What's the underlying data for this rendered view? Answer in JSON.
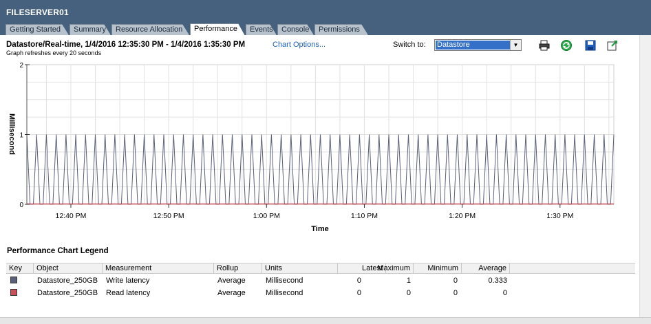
{
  "window": {
    "title": "FILESERVER01"
  },
  "tabs": [
    {
      "label": "Getting Started",
      "active": false
    },
    {
      "label": "Summary",
      "active": false
    },
    {
      "label": "Resource Allocation",
      "active": false
    },
    {
      "label": "Performance",
      "active": true
    },
    {
      "label": "Events",
      "active": false
    },
    {
      "label": "Console",
      "active": false
    },
    {
      "label": "Permissions",
      "active": false
    }
  ],
  "header": {
    "title": "Datastore/Real-time, 1/4/2016 12:35:30 PM - 1/4/2016 1:35:30 PM",
    "chart_options_link": "Chart Options...",
    "refresh_note": "Graph refreshes every 20 seconds",
    "switch_label": "Switch to:",
    "switch_value": "Datastore"
  },
  "toolbar": {
    "icons": [
      "print-icon",
      "refresh-icon",
      "save-icon",
      "popout-icon"
    ]
  },
  "chart_data": {
    "type": "line",
    "xlabel": "Time",
    "ylabel": "Millisecond",
    "ylim": [
      0,
      2
    ],
    "yticks": [
      "2",
      "1",
      "0"
    ],
    "xticks": [
      "12:40 PM",
      "12:50 PM",
      "1:00 PM",
      "1:10 PM",
      "1:20 PM",
      "1:30 PM"
    ],
    "x_start": "12:35:30 PM",
    "x_end": "1:35:30 PM",
    "sample_interval_seconds": 20,
    "grid": true,
    "series": [
      {
        "name": "Write latency",
        "color": "#5a5f7a",
        "pattern": [
          1,
          0,
          0
        ],
        "note": "repeating cycle: 1 ms then 0 ms twice, across 181 samples"
      },
      {
        "name": "Read latency",
        "color": "#c8505a",
        "constant": 0
      }
    ]
  },
  "legend": {
    "title": "Performance Chart Legend",
    "columns": [
      "Key",
      "Object",
      "Measurement",
      "Rollup",
      "Units",
      "Latest",
      "Maximum",
      "Minimum",
      "Average"
    ],
    "rows": [
      {
        "key_color": "#5a5f7a",
        "object": "Datastore_250GB",
        "measurement": "Write latency",
        "rollup": "Average",
        "units": "Millisecond",
        "latest": "0",
        "maximum": "1",
        "minimum": "0",
        "average": "0.333"
      },
      {
        "key_color": "#c8505a",
        "object": "Datastore_250GB",
        "measurement": "Read latency",
        "rollup": "Average",
        "units": "Millisecond",
        "latest": "0",
        "maximum": "0",
        "minimum": "0",
        "average": "0"
      }
    ]
  }
}
